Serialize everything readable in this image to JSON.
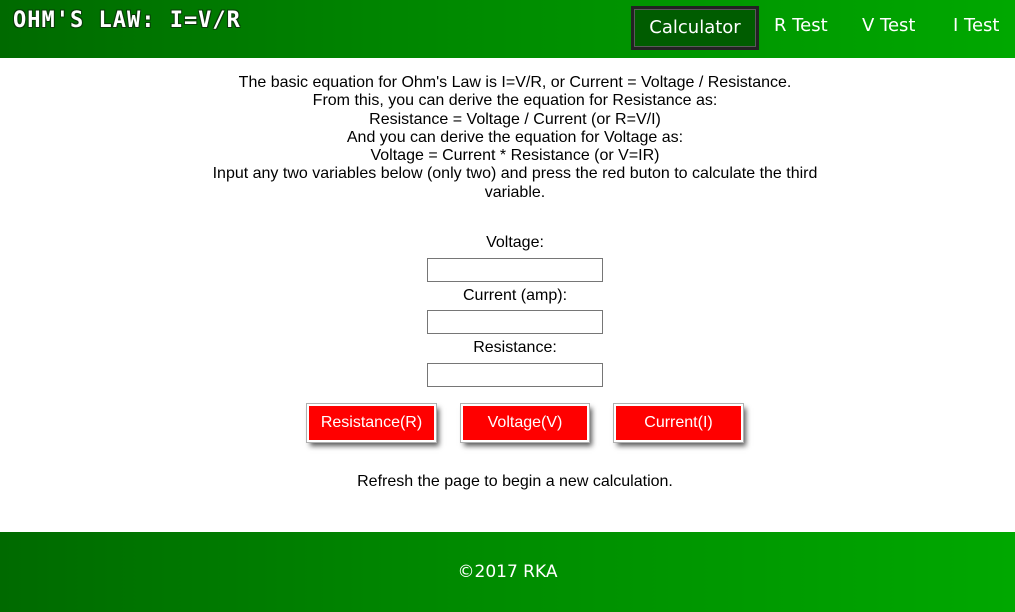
{
  "header": {
    "site_title": "OHM'S LAW: I=V/R",
    "nav": {
      "calculator": "Calculator",
      "r_test": "R Test",
      "v_test": "V Test",
      "i_test": "I Test"
    }
  },
  "intro": {
    "lines": [
      "The basic equation for Ohm's Law is I=V/R, or Current = Voltage / Resistance.",
      "From this, you can derive the equation for Resistance as:",
      "Resistance = Voltage / Current (or R=V/I)",
      "And you can derive the equation for Voltage as:",
      "Voltage = Current * Resistance (or V=IR)",
      "Input any two variables below (only two) and press the red buton to calculate the third variable."
    ]
  },
  "form": {
    "voltage_label": "Voltage:",
    "voltage_value": "",
    "current_label": "Current (amp):",
    "current_value": "",
    "resistance_label": "Resistance:",
    "resistance_value": ""
  },
  "buttons": {
    "resistance": "Resistance(R)",
    "voltage": "Voltage(V)",
    "current": "Current(I)"
  },
  "note": "Refresh the page to begin a new calculation.",
  "footer": {
    "copyright": "©2017 RKA"
  },
  "colors": {
    "header_green": "#008a00",
    "button_red": "#ff0000"
  }
}
